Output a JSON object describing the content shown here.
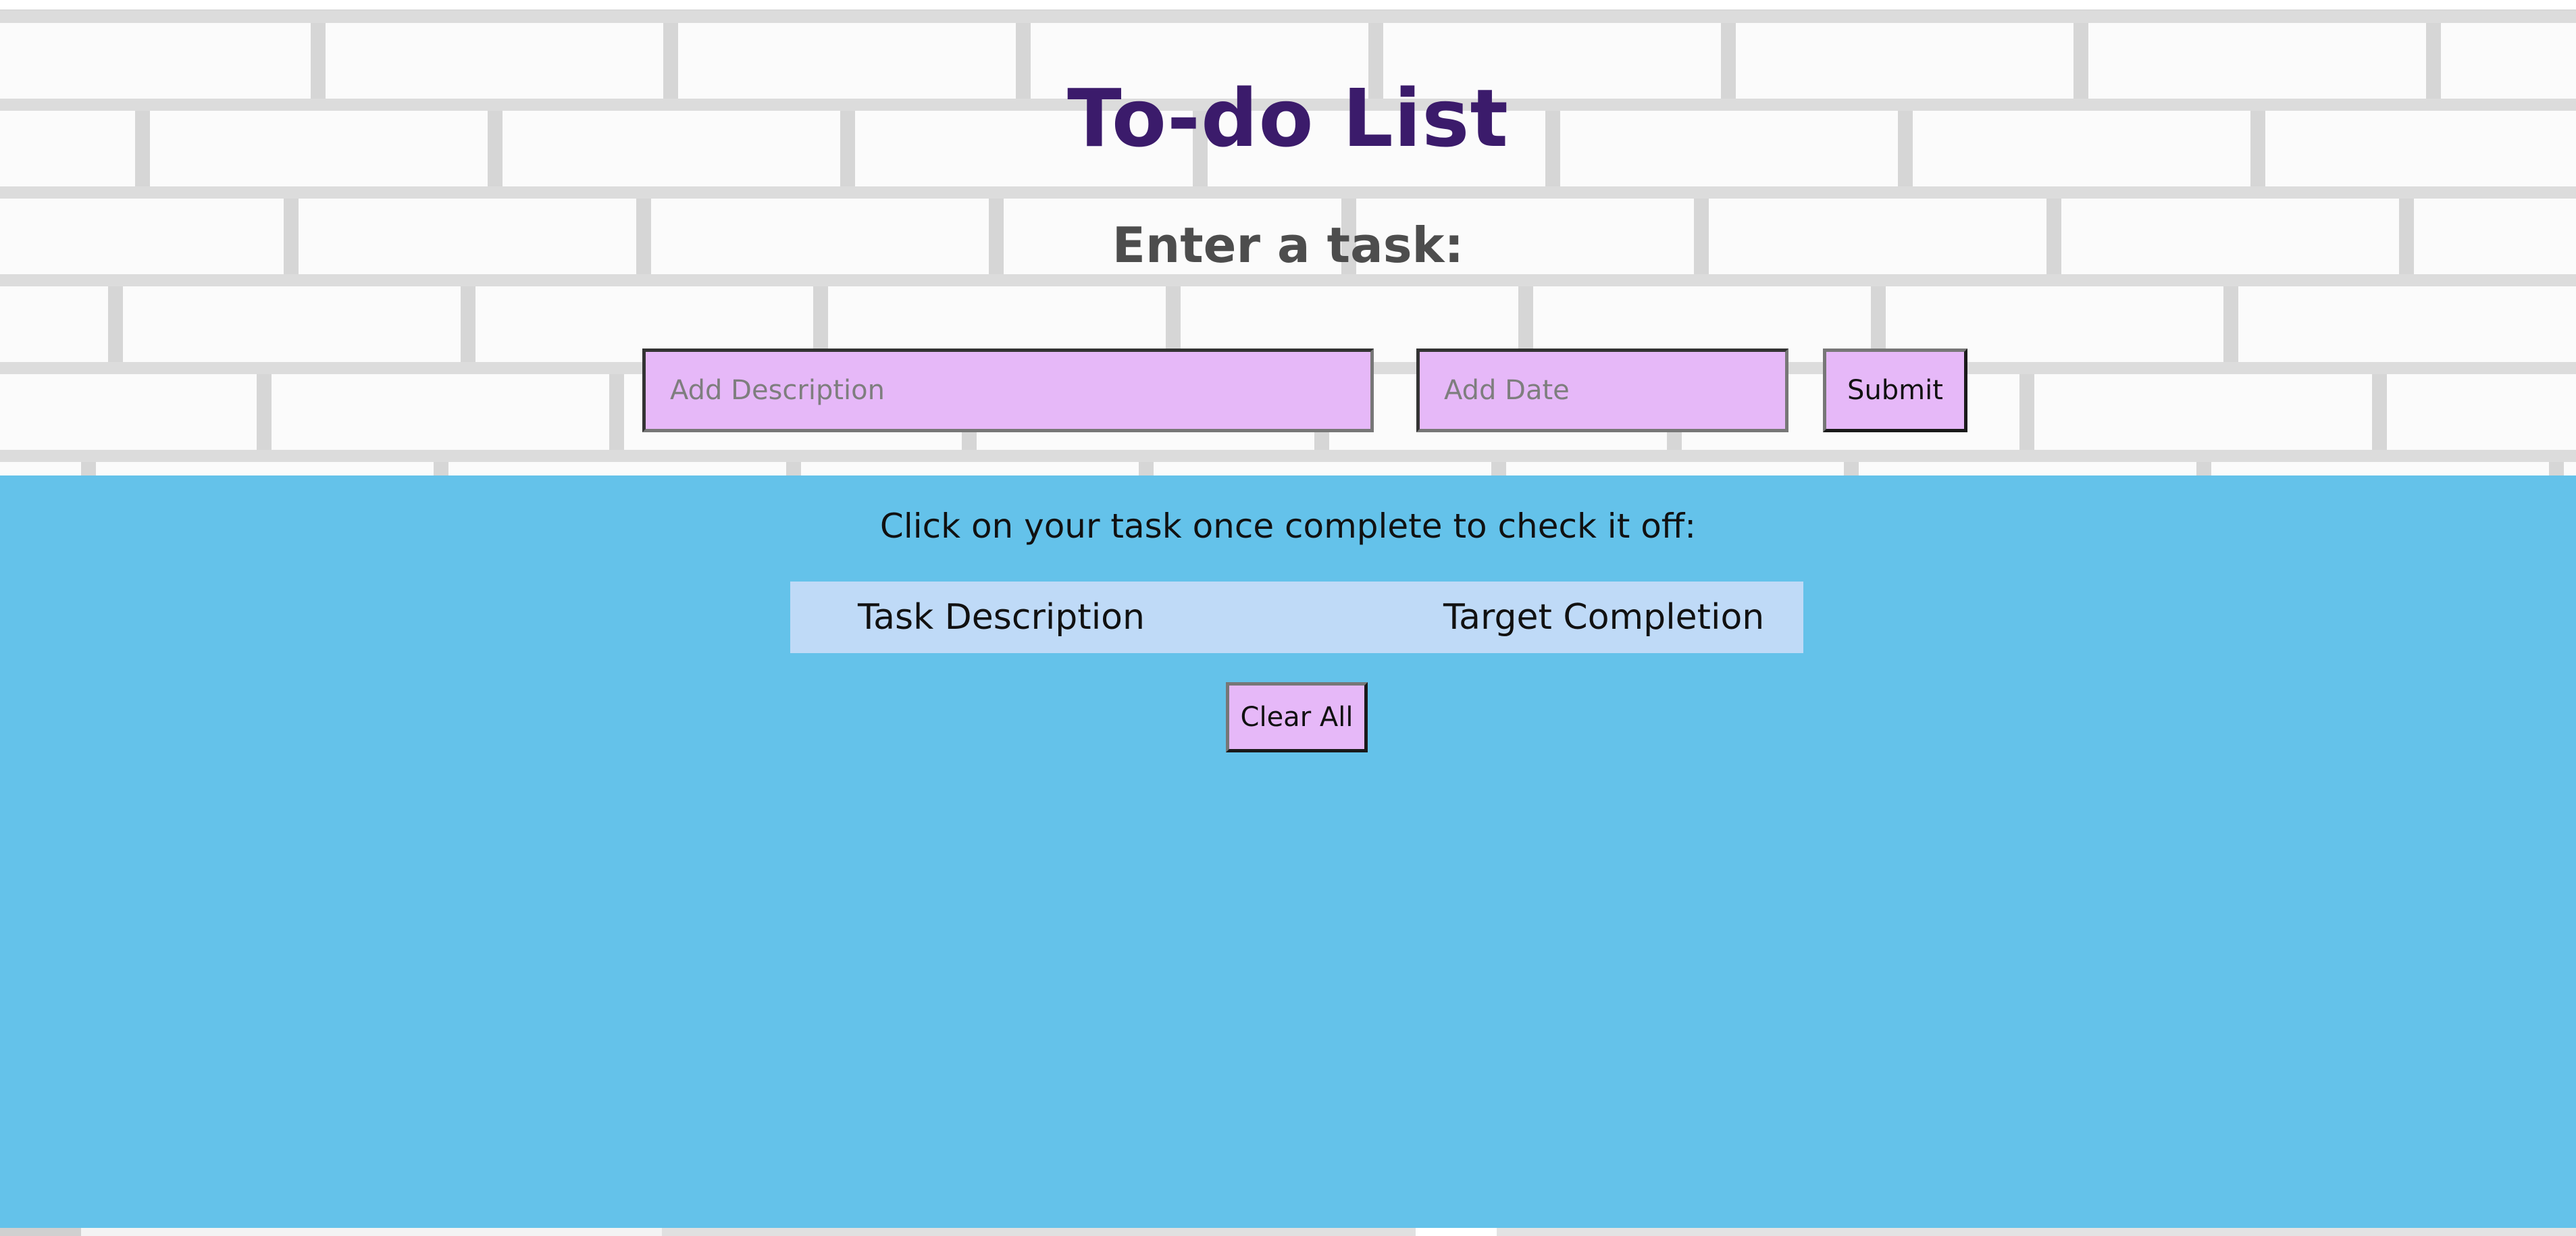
{
  "header": {
    "title": "To-do List",
    "subtitle": "Enter a task:"
  },
  "form": {
    "description_placeholder": "Add Description",
    "description_value": "",
    "date_placeholder": "Add Date",
    "date_value": "",
    "submit_label": "Submit"
  },
  "tasks": {
    "instructions": "Click on your task once complete to check it off:",
    "columns": [
      "Task Description",
      "Target Completion"
    ],
    "rows": [],
    "clear_label": "Clear All"
  },
  "colors": {
    "title": "#3b1b6b",
    "subtitle": "#4d4d4d",
    "input_background": "#e6b8f8",
    "main_background": "#64c2ea",
    "table_header_background": "#bfdaf7"
  }
}
